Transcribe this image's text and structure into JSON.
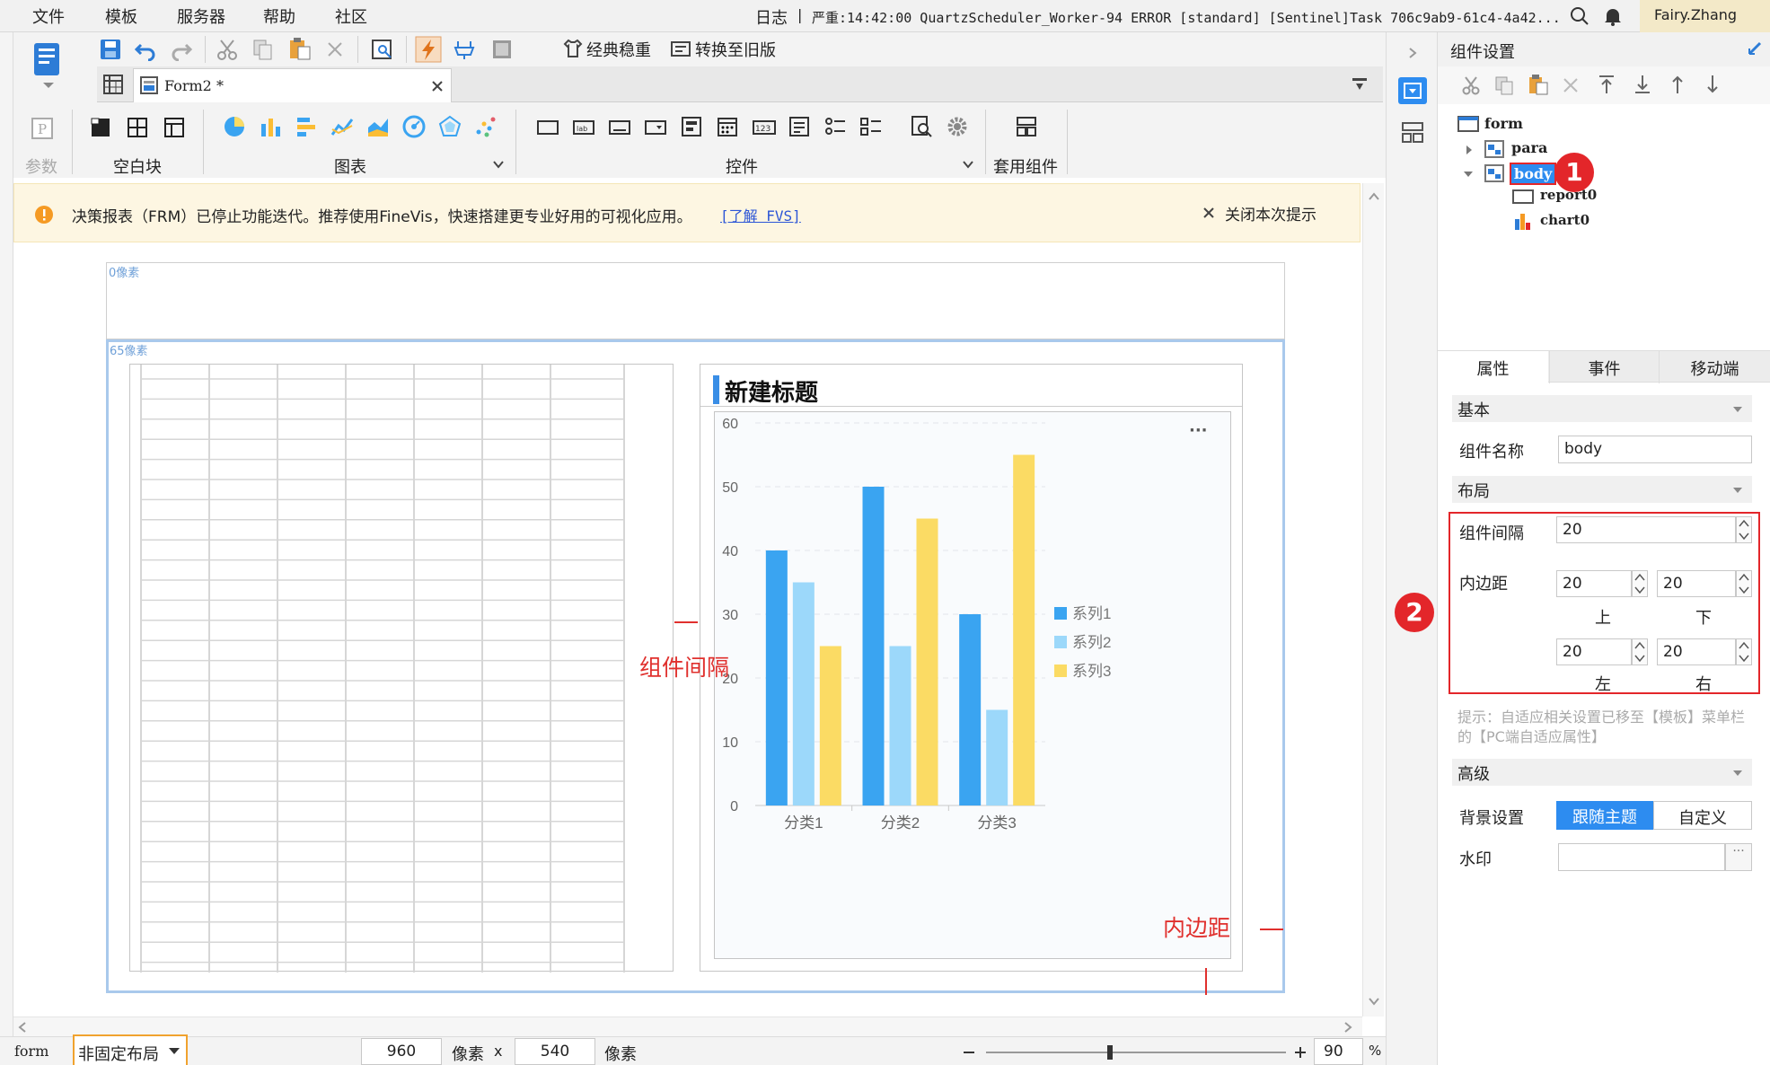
{
  "menu": {
    "items": [
      "文件",
      "模板",
      "服务器",
      "帮助",
      "社区"
    ]
  },
  "log": {
    "label": "日志",
    "text": "严重:14:42:00 QuartzScheduler_Worker-94 ERROR [standard] [Sentinel]Task 706c9ab9-61c4-4a42..."
  },
  "user": {
    "name": "Fairy.Zhang"
  },
  "toolbar": {
    "classic_btn": "经典稳重",
    "convert_btn": "转换至旧版",
    "tab_title": "Form2 *",
    "groups": {
      "param": "参数",
      "blank": "空白块",
      "chart": "图表",
      "control": "控件",
      "template": "套用组件"
    }
  },
  "notice": {
    "text": "决策报表（FRM）已停止功能迭代。推荐使用FineVis，快速搭建更专业好用的可视化应用。",
    "link": "[了解 FVS]",
    "close": "关闭本次提示"
  },
  "canvas": {
    "top_label": "0像素",
    "body_label": "65像素",
    "gap_label": "组件间隔",
    "padding_label": "内边距"
  },
  "chart_data": {
    "type": "bar",
    "title": "新建标题",
    "categories": [
      "分类1",
      "分类2",
      "分类3"
    ],
    "series": [
      {
        "name": "系列1",
        "values": [
          40,
          50,
          30
        ],
        "color": "#3aa4f1"
      },
      {
        "name": "系列2",
        "values": [
          35,
          25,
          15
        ],
        "color": "#9cd8fa"
      },
      {
        "name": "系列3",
        "values": [
          25,
          45,
          55
        ],
        "color": "#fbdb64"
      }
    ],
    "ylim": [
      0,
      60
    ],
    "yticks": [
      0,
      10,
      20,
      30,
      40,
      50,
      60
    ],
    "legend": "right",
    "grid": true
  },
  "panel": {
    "title": "组件设置",
    "tree": {
      "root": "form",
      "para": "para",
      "body": "body",
      "report": "report0",
      "chart": "chart0"
    },
    "tabs": [
      "属性",
      "事件",
      "移动端"
    ],
    "sections": {
      "basic": "基本",
      "layout": "布局",
      "advanced": "高级"
    },
    "name_label": "组件名称",
    "name_value": "body",
    "gap_label": "组件间隔",
    "gap_value": "20",
    "padding_label": "内边距",
    "pad_top": "20",
    "pad_bottom": "20",
    "pad_left": "20",
    "pad_right": "20",
    "top": "上",
    "bottom": "下",
    "left": "左",
    "right": "右",
    "hint": "提示：自适应相关设置已移至【模板】菜单栏的【PC端自适应属性】",
    "bg_label": "背景设置",
    "bg_follow": "跟随主题",
    "bg_custom": "自定义",
    "watermark_label": "水印"
  },
  "status": {
    "name": "form",
    "layout": "非固定布局",
    "width": "960",
    "unit1": "像素",
    "x": "x",
    "height": "540",
    "unit2": "像素",
    "zoom": "90",
    "pct": "%"
  },
  "badges": {
    "one": "1",
    "two": "2"
  }
}
